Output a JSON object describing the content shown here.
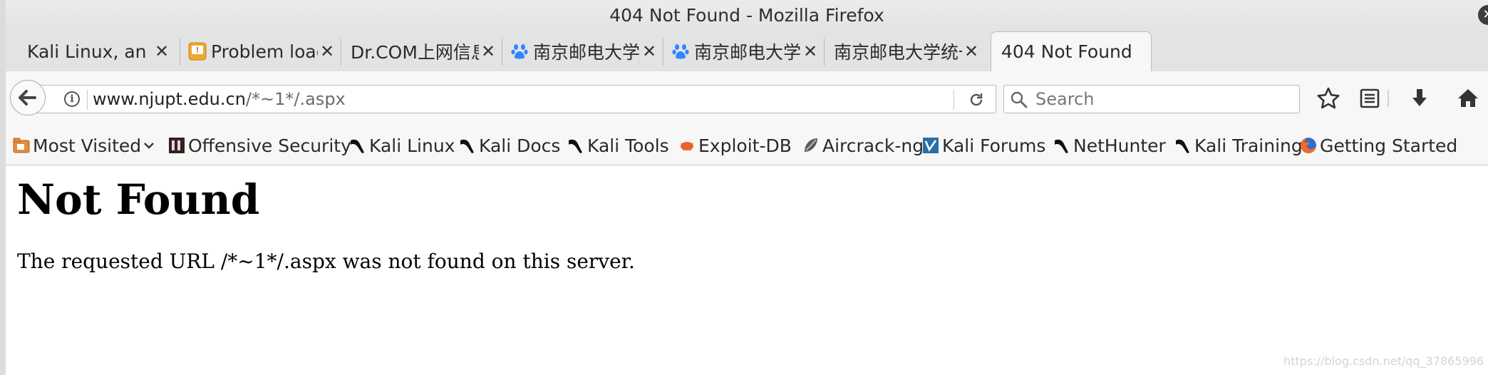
{
  "window": {
    "title": "404 Not Found - Mozilla Firefox"
  },
  "tabs": [
    {
      "label": "Kali Linux, an Offe...",
      "icon": "none"
    },
    {
      "label": "Problem loadin...",
      "icon": "warning-icon"
    },
    {
      "label": "Dr.COM上网信息窗",
      "icon": "none"
    },
    {
      "label": "南京邮电大学_...",
      "icon": "baidu-paw-icon"
    },
    {
      "label": "南京邮电大学...",
      "icon": "baidu-paw-icon"
    },
    {
      "label": "南京邮电大学统一...",
      "icon": "none"
    },
    {
      "label": "404 Not Found",
      "icon": "none",
      "active": true
    }
  ],
  "navbar": {
    "url_host": "www.njupt.edu.cn",
    "url_path": "/*~1*/.aspx",
    "search_placeholder": "Search"
  },
  "bookmarks": [
    {
      "label": "Most Visited",
      "icon": "folder-icon"
    },
    {
      "label": "Offensive Security",
      "icon": "offsec-icon"
    },
    {
      "label": "Kali Linux",
      "icon": "kali-dragon-icon"
    },
    {
      "label": "Kali Docs",
      "icon": "kali-dragon-icon"
    },
    {
      "label": "Kali Tools",
      "icon": "kali-dragon-icon"
    },
    {
      "label": "Exploit-DB",
      "icon": "exploitdb-icon"
    },
    {
      "label": "Aircrack-ng",
      "icon": "aircrack-icon"
    },
    {
      "label": "Kali Forums",
      "icon": "forums-icon"
    },
    {
      "label": "NetHunter",
      "icon": "kali-dragon-icon"
    },
    {
      "label": "Kali Training",
      "icon": "kali-dragon-icon"
    },
    {
      "label": "Getting Started",
      "icon": "firefox-icon"
    }
  ],
  "page": {
    "heading": "Not Found",
    "message": "The requested URL /*~1*/.aspx was not found on this server."
  },
  "watermark": "https://blog.csdn.net/qq_37865996",
  "colors": {
    "titlebar": "#e3e3e3",
    "toolbar": "#f7f7f7",
    "baidu_blue": "#3385ff"
  }
}
